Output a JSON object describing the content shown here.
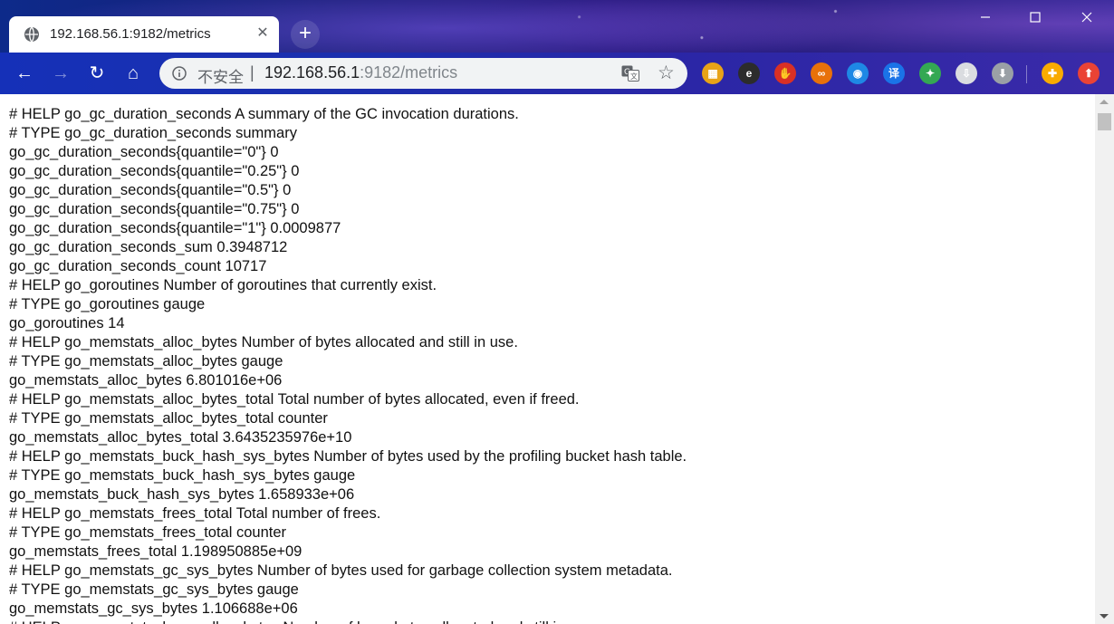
{
  "tab": {
    "title": "192.168.56.1:9182/metrics",
    "close_glyph": "✕",
    "favicon": "globe-icon"
  },
  "new_tab_glyph": "+",
  "window_controls": {
    "minimize": "—",
    "maximize": "☐",
    "close": "✕"
  },
  "toolbar": {
    "back_glyph": "←",
    "forward_glyph": "→",
    "reload_glyph": "↻",
    "home_glyph": "⌂"
  },
  "omnibox": {
    "security_label": "不安全",
    "separator": "|",
    "url_host": "192.168.56.1",
    "url_rest": ":9182/metrics",
    "star_glyph": "☆"
  },
  "extensions": [
    {
      "name": "colorful-grid-extension-icon",
      "glyph": "▦",
      "color": "#e8a317"
    },
    {
      "name": "ie-tab-extension-icon",
      "glyph": "e",
      "color": "#2c2c2c"
    },
    {
      "name": "adblock-hand-extension-icon",
      "glyph": "✋",
      "color": "#d93025"
    },
    {
      "name": "infinity-extension-icon",
      "glyph": "∞",
      "color": "#e8710a"
    },
    {
      "name": "circle-refresh-extension-icon",
      "glyph": "◉",
      "color": "#1e88e5"
    },
    {
      "name": "translate-yi-extension-icon",
      "glyph": "译",
      "color": "#1a73e8"
    },
    {
      "name": "puzzle-extension-icon",
      "glyph": "✦",
      "color": "#34a853"
    },
    {
      "name": "download-cloud-extension-icon",
      "glyph": "⇩",
      "color": "#dadce0"
    },
    {
      "name": "download-circle-extension-icon",
      "glyph": "⬇",
      "color": "#9aa0a6"
    },
    {
      "name": "puzzle-yellow-extension-icon",
      "glyph": "✚",
      "color": "#f9ab00"
    },
    {
      "name": "upload-red-extension-icon",
      "glyph": "⬆",
      "color": "#ea4335"
    }
  ],
  "metrics_lines": [
    "# HELP go_gc_duration_seconds A summary of the GC invocation durations.",
    "# TYPE go_gc_duration_seconds summary",
    "go_gc_duration_seconds{quantile=\"0\"} 0",
    "go_gc_duration_seconds{quantile=\"0.25\"} 0",
    "go_gc_duration_seconds{quantile=\"0.5\"} 0",
    "go_gc_duration_seconds{quantile=\"0.75\"} 0",
    "go_gc_duration_seconds{quantile=\"1\"} 0.0009877",
    "go_gc_duration_seconds_sum 0.3948712",
    "go_gc_duration_seconds_count 10717",
    "# HELP go_goroutines Number of goroutines that currently exist.",
    "# TYPE go_goroutines gauge",
    "go_goroutines 14",
    "# HELP go_memstats_alloc_bytes Number of bytes allocated and still in use.",
    "# TYPE go_memstats_alloc_bytes gauge",
    "go_memstats_alloc_bytes 6.801016e+06",
    "# HELP go_memstats_alloc_bytes_total Total number of bytes allocated, even if freed.",
    "# TYPE go_memstats_alloc_bytes_total counter",
    "go_memstats_alloc_bytes_total 3.6435235976e+10",
    "# HELP go_memstats_buck_hash_sys_bytes Number of bytes used by the profiling bucket hash table.",
    "# TYPE go_memstats_buck_hash_sys_bytes gauge",
    "go_memstats_buck_hash_sys_bytes 1.658933e+06",
    "# HELP go_memstats_frees_total Total number of frees.",
    "# TYPE go_memstats_frees_total counter",
    "go_memstats_frees_total 1.198950885e+09",
    "# HELP go_memstats_gc_sys_bytes Number of bytes used for garbage collection system metadata.",
    "# TYPE go_memstats_gc_sys_bytes gauge",
    "go_memstats_gc_sys_bytes 1.106688e+06",
    "# HELP go_memstats_heap_alloc_bytes Number of heap bytes allocated and still in use."
  ]
}
